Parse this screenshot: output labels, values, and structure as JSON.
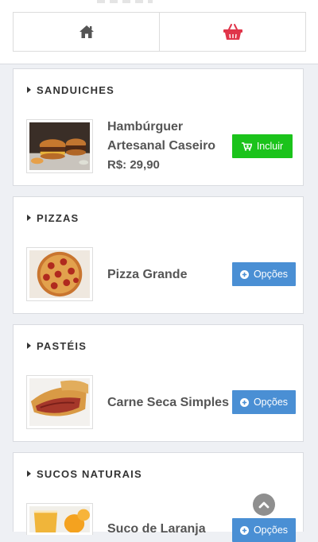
{
  "nav": {
    "home_icon": "home-icon",
    "basket_icon": "basket-icon",
    "basket_color": "#e0354a"
  },
  "categories": [
    {
      "title": "SANDUICHES",
      "product": {
        "name_line1": "Hambúrguer",
        "name_line2": "Artesanal Caseiro",
        "price": "R$: 29,90",
        "image": "burger-image"
      },
      "button": {
        "label": "Incluir",
        "icon": "cart-plus-icon",
        "color": "#1bc31b"
      }
    },
    {
      "title": "PIZZAS",
      "product": {
        "name": "Pizza Grande",
        "image": "pizza-image"
      },
      "button": {
        "label": "Opções",
        "icon": "plus-circle-icon",
        "color": "#4a8fd4"
      }
    },
    {
      "title": "PASTÉIS",
      "product": {
        "name": "Carne Seca Simples",
        "image": "pastel-image"
      },
      "button": {
        "label": "Opções",
        "icon": "plus-circle-icon",
        "color": "#4a8fd4"
      }
    },
    {
      "title": "SUCOS NATURAIS",
      "product": {
        "name": "Suco de Laranja",
        "image": "juice-image"
      },
      "button": {
        "label": "Opções",
        "icon": "plus-circle-icon",
        "color": "#4a8fd4"
      }
    }
  ],
  "scroll_top_icon": "chevron-up-circle-icon"
}
